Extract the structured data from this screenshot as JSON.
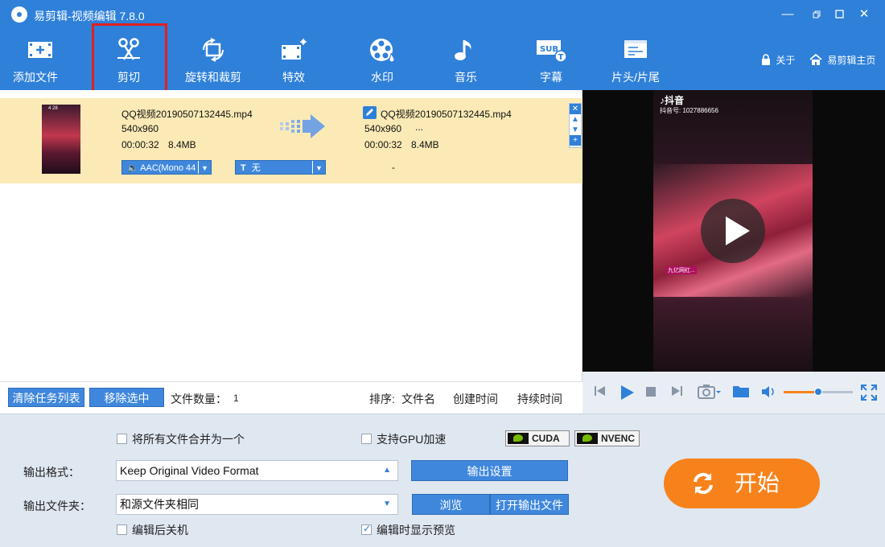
{
  "window": {
    "title": "易剪辑-视频编辑 7.8.0"
  },
  "toolbar": {
    "items": [
      {
        "label": "添加文件",
        "icon": "add-file-icon"
      },
      {
        "label": "剪切",
        "icon": "scissors-icon"
      },
      {
        "label": "旋转和裁剪",
        "icon": "crop-rotate-icon"
      },
      {
        "label": "特效",
        "icon": "effects-icon"
      },
      {
        "label": "水印",
        "icon": "watermark-icon"
      },
      {
        "label": "音乐",
        "icon": "music-icon"
      },
      {
        "label": "字幕",
        "icon": "subtitle-icon"
      },
      {
        "label": "片头/片尾",
        "icon": "intro-outro-icon"
      }
    ],
    "about": "关于",
    "home": "易剪辑主页"
  },
  "file": {
    "source": {
      "name": "QQ视频20190507132445.mp4",
      "resolution": "540x960",
      "duration": "00:00:32",
      "size": "8.4MB"
    },
    "output": {
      "name": "QQ视频20190507132445.mp4",
      "resolution": "540x960",
      "extra": "...",
      "duration": "00:00:32",
      "size": "8.4MB"
    },
    "audio_track": "AAC(Mono 44",
    "subtitle_track": "无",
    "dash": "-",
    "thumb_tag": "4 28"
  },
  "preview": {
    "app_name": "抖音",
    "account": "抖音号: 1027886656",
    "caption": "九亿网红..."
  },
  "listbar": {
    "clear_label": "清除任务列表",
    "remove_label": "移除选中",
    "count_label": "文件数量：",
    "count_value": "1",
    "sort_label": "排序:",
    "sort_name": "文件名",
    "sort_created": "创建时间",
    "sort_duration": "持续时间"
  },
  "settings": {
    "merge_label": "将所有文件合并为一个",
    "merge_checked": false,
    "gpu_label": "支持GPU加速",
    "gpu_checked": false,
    "cuda": "CUDA",
    "nvenc": "NVENC",
    "format_label": "输出格式：",
    "format_value": "Keep Original Video Format",
    "output_settings": "输出设置",
    "folder_label": "输出文件夹：",
    "folder_value": "和源文件夹相同",
    "browse": "浏览",
    "open_output": "打开输出文件",
    "shutdown_label": "编辑后关机",
    "shutdown_checked": false,
    "preview_label": "编辑时显示预览",
    "preview_checked": true,
    "start": "开始"
  },
  "colors": {
    "primary": "#2f80d9",
    "row_highlight": "#fbeab6",
    "start": "#f7821b",
    "highlight_box": "#e02020"
  }
}
